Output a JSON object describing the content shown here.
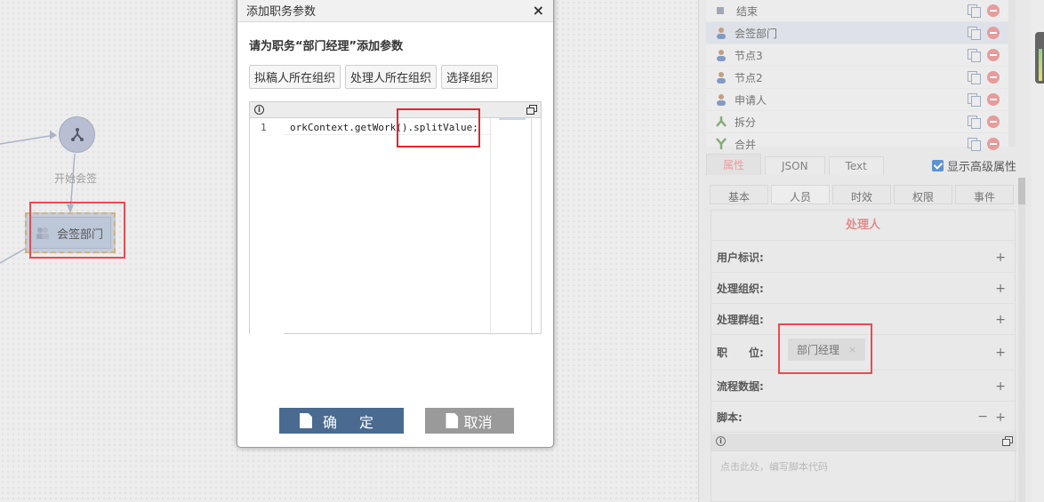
{
  "canvas": {
    "start_sign_label": "开始会签",
    "countersign_node_label": "会签部门"
  },
  "node_list": {
    "items": [
      {
        "label": "结束",
        "icon": "end-square-icon"
      },
      {
        "label": "会签部门",
        "icon": "person-icon",
        "selected": true
      },
      {
        "label": "节点3",
        "icon": "person-icon"
      },
      {
        "label": "节点2",
        "icon": "person-icon"
      },
      {
        "label": "申请人",
        "icon": "person-icon"
      },
      {
        "label": "拆分",
        "icon": "split-icon"
      },
      {
        "label": "合并",
        "icon": "merge-icon"
      }
    ]
  },
  "property_tabs": {
    "tabs": [
      "属性",
      "JSON",
      "Text"
    ],
    "show_advanced_label": "显示高级属性"
  },
  "sub_tabs": [
    "基本",
    "人员",
    "时效",
    "权限",
    "事件"
  ],
  "handler": {
    "title": "处理人",
    "user_id_label": "用户标识:",
    "org_label": "处理组织:",
    "group_label": "处理群组:",
    "position_label": "职　　位:",
    "position_tag": "部门经理",
    "flow_data_label": "流程数据:",
    "script_label": "脚本:",
    "script_placeholder": "点击此处，编写脚本代码",
    "plus": "+",
    "minus": "−",
    "tag_close": "×"
  },
  "dialog": {
    "title": "添加职务参数",
    "close": "×",
    "prompt": "请为职务“部门经理”添加参数",
    "buttons": [
      "拟稿人所在组织",
      "处理人所在组织",
      "选择组织"
    ],
    "editor": {
      "line_number": "1",
      "code": "orkContext.getWork().splitValue;",
      "info": "i"
    },
    "ok_label": "确 定",
    "cancel_label": "取消"
  },
  "colors": {
    "highlight": "#e5242b",
    "primary_button": "#4a6a90",
    "secondary_button": "#9a9a9a",
    "accent_red": "#d97373"
  }
}
